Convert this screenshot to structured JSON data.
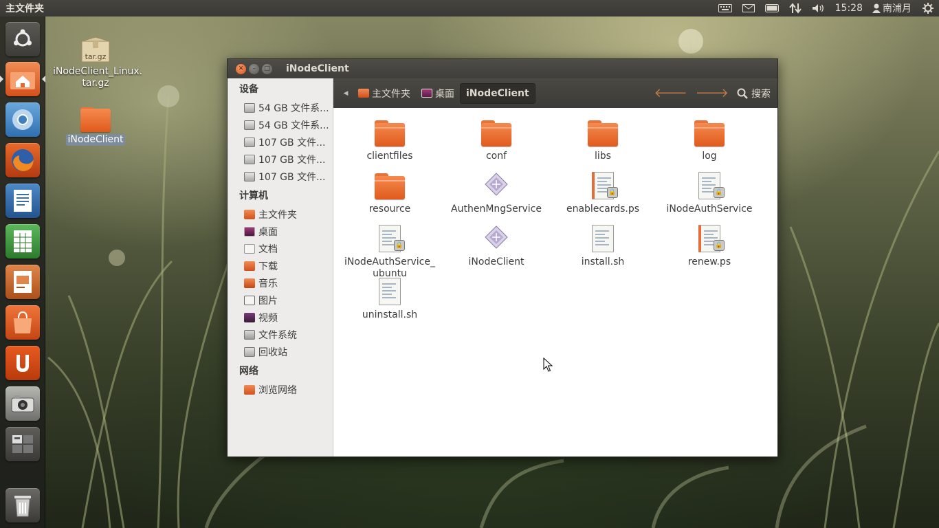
{
  "top_panel": {
    "title": "主文件夹",
    "clock": "15:28",
    "user": "南浦月"
  },
  "desktop": {
    "icons": [
      {
        "label": "iNodeClient_Linux.\ntar.gz",
        "badge": "tar.gz",
        "line1": "iNodeClient_Linux.",
        "line2": "tar.gz"
      },
      {
        "label": "iNodeClient"
      }
    ]
  },
  "window": {
    "title": "iNodeClient",
    "sidebar": {
      "devices_header": "设备",
      "devices": [
        "54 GB 文件系...",
        "54 GB 文件系...",
        "107 GB 文件...",
        "107 GB 文件...",
        "107 GB 文件..."
      ],
      "computer_header": "计算机",
      "computer": [
        "主文件夹",
        "桌面",
        "文档",
        "下载",
        "音乐",
        "图片",
        "视频",
        "文件系统",
        "回收站"
      ],
      "network_header": "网络",
      "network": [
        "浏览网络"
      ]
    },
    "toolbar": {
      "crumbs": [
        "主文件夹",
        "桌面",
        "iNodeClient"
      ],
      "search_label": "搜索"
    },
    "files": [
      {
        "name": "clientfiles"
      },
      {
        "name": "conf"
      },
      {
        "name": "libs"
      },
      {
        "name": "log"
      },
      {
        "name": "resource"
      },
      {
        "name": "AuthenMngService"
      },
      {
        "name": "enablecards.ps"
      },
      {
        "name": "iNodeAuthService"
      },
      {
        "name": "iNodeAuthService_",
        "line2": "ubuntu"
      },
      {
        "name": "iNodeClient"
      },
      {
        "name": "install.sh"
      },
      {
        "name": "renew.ps"
      },
      {
        "name": "uninstall.sh"
      }
    ]
  },
  "colors": {
    "accent": "#dd4814",
    "folder": "#e9692c",
    "panel": "#3c3b37",
    "selection": "#7d8c9c"
  }
}
